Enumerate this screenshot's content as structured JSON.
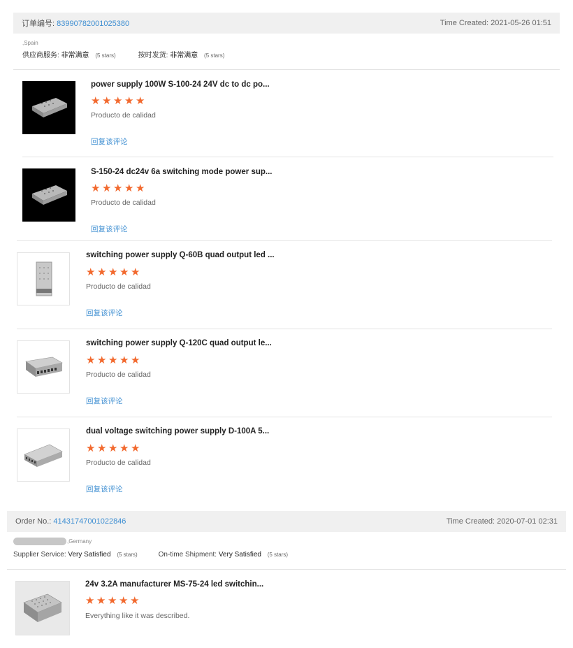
{
  "orders": [
    {
      "order_label": "订单编号:",
      "order_number": "83990782001025380",
      "time_created": "Time Created: 2021-05-26 01:51",
      "buyer_country": ",Spain",
      "supplier_label": "供应商服务:",
      "supplier_value": "非常满意",
      "supplier_stars": "(5 stars)",
      "shipment_label": "按时发货:",
      "shipment_value": "非常满意",
      "shipment_stars": "(5 stars)",
      "items": [
        {
          "title": "power supply 100W S-100-24 24V dc to dc po...",
          "rating": 5,
          "feedback": "Producto de calidad",
          "reply": "回复该评论",
          "thumb": "psu-dark"
        },
        {
          "title": "S-150-24 dc24v 6a switching mode power sup...",
          "rating": 5,
          "feedback": "Producto de calidad",
          "reply": "回复该评论",
          "thumb": "psu-dark"
        },
        {
          "title": "switching power supply Q-60B quad output led ...",
          "rating": 5,
          "feedback": "Producto de calidad",
          "reply": "回复该评论",
          "thumb": "psu-standing"
        },
        {
          "title": "switching power supply Q-120C quad output le...",
          "rating": 5,
          "feedback": "Producto de calidad",
          "reply": "回复该评论",
          "thumb": "psu-flat"
        },
        {
          "title": "dual voltage switching power supply D-100A 5...",
          "rating": 5,
          "feedback": "Producto de calidad",
          "reply": "回复该评论",
          "thumb": "psu-angled"
        }
      ]
    },
    {
      "order_label": "Order No.:",
      "order_number": "41431747001022846",
      "time_created": "Time Created: 2020-07-01 02:31",
      "buyer_country": ",Germany",
      "supplier_label": "Supplier Service:",
      "supplier_value": "Very Satisfied",
      "supplier_stars": "(5 stars)",
      "shipment_label": "On-time Shipment:",
      "shipment_value": "Very Satisfied",
      "shipment_stars": "(5 stars)",
      "items": [
        {
          "title": "24v 3.2A manufacturer MS-75-24 led switchin...",
          "rating": 5,
          "feedback": "Everything like it was described.",
          "thumb": "psu-photo"
        }
      ]
    }
  ],
  "star_glyph": "★",
  "star_color": "#f2692e",
  "link_color": "#3f8fd2"
}
